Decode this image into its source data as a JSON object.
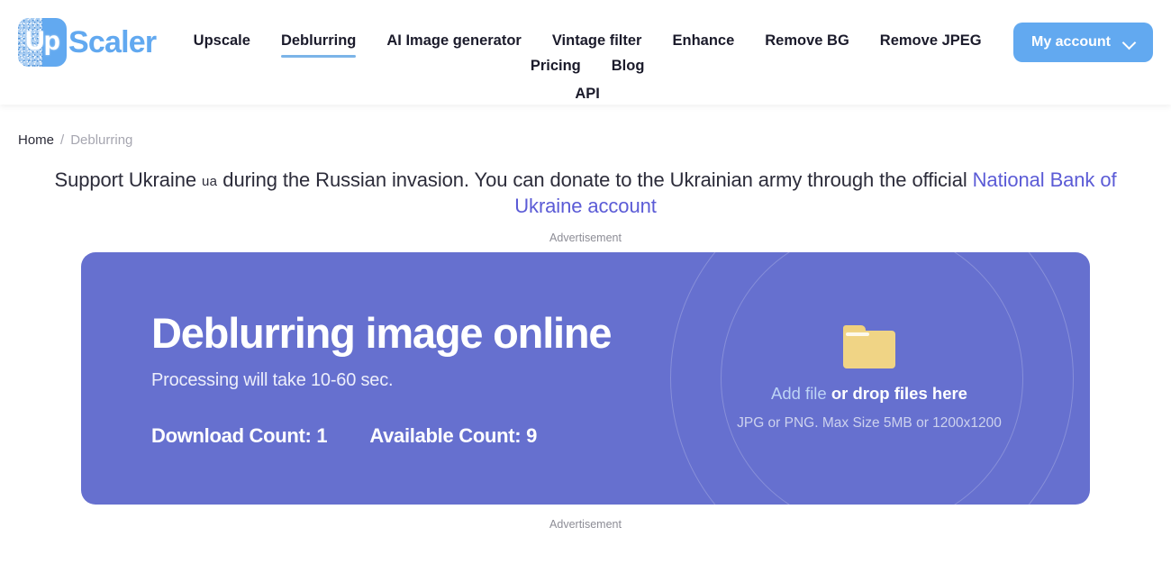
{
  "header": {
    "logo": {
      "mark_text": "Up",
      "word": "Scaler",
      "accent_color": "#62a9f0"
    },
    "nav_row1": [
      {
        "label": "Upscale",
        "active": false
      },
      {
        "label": "Deblurring",
        "active": true
      },
      {
        "label": "AI Image generator",
        "active": false
      },
      {
        "label": "Vintage filter",
        "active": false
      },
      {
        "label": "Enhance",
        "active": false
      },
      {
        "label": "Remove BG",
        "active": false
      },
      {
        "label": "Remove JPEG",
        "active": false
      },
      {
        "label": "Pricing",
        "active": false
      },
      {
        "label": "Blog",
        "active": false
      }
    ],
    "nav_row2": [
      {
        "label": "API",
        "active": false
      }
    ],
    "account_button": {
      "label": "My account",
      "icon": "chevron-down-icon",
      "background_color": "#62a9f0"
    }
  },
  "breadcrumb": {
    "home": "Home",
    "separator": "/",
    "current": "Deblurring"
  },
  "ukraine_banner": {
    "text_before_flag": "Support Ukraine ",
    "flag": "ua",
    "text_after_flag": " during the Russian invasion. You can donate to the Ukrainian army through the official ",
    "link_text": "National Bank of Ukraine account",
    "link_color": "#5b5bd6"
  },
  "ads": {
    "top_label": "Advertisement",
    "bottom_label": "Advertisement"
  },
  "hero": {
    "background_color": "#6670cf",
    "title": "Deblurring image online",
    "subtitle": "Processing will take 10-60 sec.",
    "counts": [
      {
        "label": "Download Count:",
        "value": "1"
      },
      {
        "label": "Available Count:",
        "value": "9"
      }
    ],
    "dropzone": {
      "icon": "folder-icon",
      "add_link": "Add file",
      "drop_text": " or drop files here",
      "hint": "JPG or PNG. Max Size 5MB or 1200x1200"
    }
  }
}
